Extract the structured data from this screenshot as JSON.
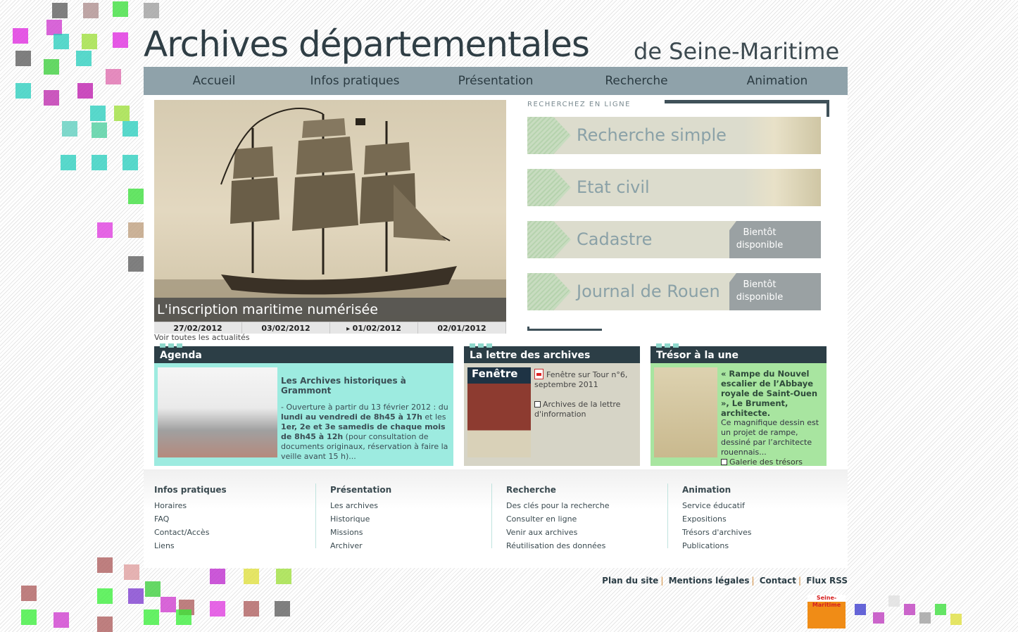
{
  "header": {
    "title": "Archives départementales",
    "subtitle": "de Seine-Maritime"
  },
  "nav": [
    "Accueil",
    "Infos pratiques",
    "Présentation",
    "Recherche",
    "Animation"
  ],
  "slideshow": {
    "caption": "L'inscription maritime numérisée",
    "dates": [
      "27/02/2012",
      "03/02/2012",
      "01/02/2012",
      "02/01/2012"
    ],
    "active_index": 2,
    "see_all": "Voir toutes les actualités"
  },
  "search": {
    "title": "RECHERCHEZ EN LIGNE",
    "buttons": [
      {
        "label": "Recherche simple",
        "badge": ""
      },
      {
        "label": "Etat civil",
        "badge": ""
      },
      {
        "label": "Cadastre",
        "badge": "Bientôt disponible"
      },
      {
        "label": "Journal de Rouen",
        "badge": "Bientôt disponible"
      }
    ]
  },
  "agenda": {
    "heading": "Agenda",
    "title": "Les Archives historiques à Grammont",
    "text_1": "- Ouverture à partir du 13 février 2012 : du ",
    "bold_1": "lundi au vendredi de 8h45 à 17h",
    "text_2": " et les ",
    "bold_2": "1er, 2e et 3e samedis de chaque mois de 8h45 à 12h",
    "text_3": " (pour consultation de documents originaux, réservation à faire la veille avant 15 h)..."
  },
  "lettre": {
    "heading": "La lettre des archives",
    "pdf_text": "Fenêtre sur Tour n°6, septembre 2011",
    "link_text": "Archives de la lettre d'information",
    "cover_title": "Fenêtre"
  },
  "tresor": {
    "heading": "Trésor à la une",
    "title": "« Rampe du Nouvel escalier de l’Abbaye royale de Saint-Ouen », Le Brument, architecte.",
    "text": "Ce magnifique dessin est un projet de rampe, dessiné par l’architecte rouennais...",
    "link_text": "Galerie des trésors"
  },
  "footer": {
    "columns": [
      {
        "heading": "Infos pratiques",
        "items": [
          "Horaires",
          "FAQ",
          "Contact/Accès",
          "Liens"
        ]
      },
      {
        "heading": "Présentation",
        "items": [
          "Les archives",
          "Historique",
          "Missions",
          "Archiver"
        ]
      },
      {
        "heading": "Recherche",
        "items": [
          "Des clés pour la recherche",
          "Consulter en ligne",
          "Venir aux archives",
          "Réutilisation des données"
        ]
      },
      {
        "heading": "Animation",
        "items": [
          "Service éducatif",
          "Expositions",
          "Trésors d'archives",
          "Publications"
        ]
      }
    ],
    "legal": [
      "Plan du site",
      "Mentions légales",
      "Contact",
      "Flux RSS"
    ],
    "logo_text": "Seine-Maritime"
  },
  "colors": {
    "nav_bg": "#8fa2aa",
    "box_head": "#2c3e46",
    "agenda_bg": "#9debe0",
    "lettre_bg": "#d6d4c6",
    "tresor_bg": "#a8e5a0",
    "logo_orange": "#f08c16"
  }
}
